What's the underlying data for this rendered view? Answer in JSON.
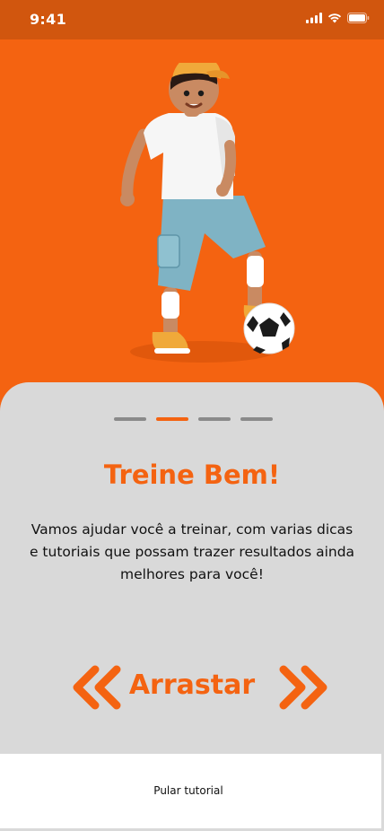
{
  "status_bar": {
    "time": "9:41",
    "icons": [
      "signal-icon",
      "wifi-icon",
      "battery-icon"
    ]
  },
  "hero": {
    "illustration": "boy-with-soccer-ball-illustration"
  },
  "onboarding": {
    "page_indicator": {
      "total": 4,
      "active_index": 1
    },
    "title": "Treine Bem!",
    "description": "Vamos ajudar você a treinar, com varias dicas e tutoriais que possam trazer resultados ainda melhores para você!",
    "swipe_label": "Arrastar",
    "skip_label": "Pular tutorial"
  },
  "colors": {
    "accent": "#f46311",
    "status_bar": "#d1560e",
    "panel_background": "#d9d9d9",
    "skip_background": "#ffffff"
  }
}
